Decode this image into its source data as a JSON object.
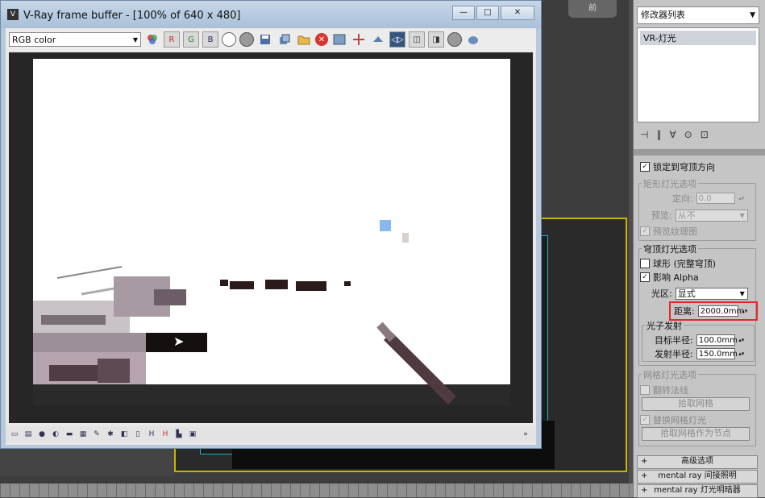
{
  "viewport": {
    "gizmo_label": "前"
  },
  "vfb": {
    "title": "V-Ray frame buffer - [100% of 640 x 480]",
    "logo": "V",
    "window_buttons": {
      "minimize": "—",
      "maximize": "□",
      "close": "✕"
    },
    "channel": "RGB color",
    "channel_buttons": [
      "R",
      "G",
      "B"
    ],
    "statusbar_icons": [
      "▭",
      "▤",
      "●",
      "◐",
      "▬",
      "▦",
      "✎",
      "✱",
      "◧",
      "▯",
      "H",
      "H",
      "▙",
      "▣"
    ],
    "canvas_cursor": "➤"
  },
  "panel": {
    "modifier_list": "修改器列表",
    "stack_items": [
      "VR-灯光"
    ],
    "stack_tools": [
      "⊣",
      "‖",
      "∀",
      "⊙",
      "⊡"
    ],
    "lock_dome": {
      "label": "锁定到穹顶方向",
      "checked": true
    },
    "rect_options": {
      "title": "矩形灯光选项",
      "directional_label": "定向:",
      "directional_value": "0.0",
      "preview_label": "预览:",
      "preview_value": "从不",
      "preview_texture": {
        "label": "预览纹理图",
        "checked": true
      }
    },
    "dome_options": {
      "title": "穹顶灯光选项",
      "spherical": {
        "label": "球形 (完整穹顶)",
        "checked": false
      },
      "affect_alpha": {
        "label": "影响 Alpha",
        "checked": true
      },
      "region_label": "光区:",
      "region_value": "显式",
      "distance_label": "距离:",
      "distance_value": "2000.0mm",
      "photon_title": "光子发射",
      "target_radius_label": "目标半径:",
      "target_radius_value": "100.0mm",
      "emit_radius_label": "发射半径:",
      "emit_radius_value": "150.0mm"
    },
    "mesh_options": {
      "title": "网格灯光选项",
      "flip_normal": {
        "label": "翻转法线",
        "checked": false
      },
      "pick_mesh": "拾取网格",
      "replace_mesh": {
        "label": "替换网格灯光",
        "checked": true
      },
      "pick_mesh_node": "拾取网格作为节点"
    },
    "rollouts": [
      {
        "sign": "+",
        "label": "高级选项"
      },
      {
        "sign": "+",
        "label": "mental ray 间接照明"
      },
      {
        "sign": "+",
        "label": "mental ray 灯光明暗器"
      }
    ],
    "spinner_arrow": "▴▾",
    "dropdown_arrow": "▼"
  },
  "colors": {
    "viewport_border": "#c9b400",
    "highlight": "#e8262d",
    "vfb_title": "#b5c8dd"
  }
}
